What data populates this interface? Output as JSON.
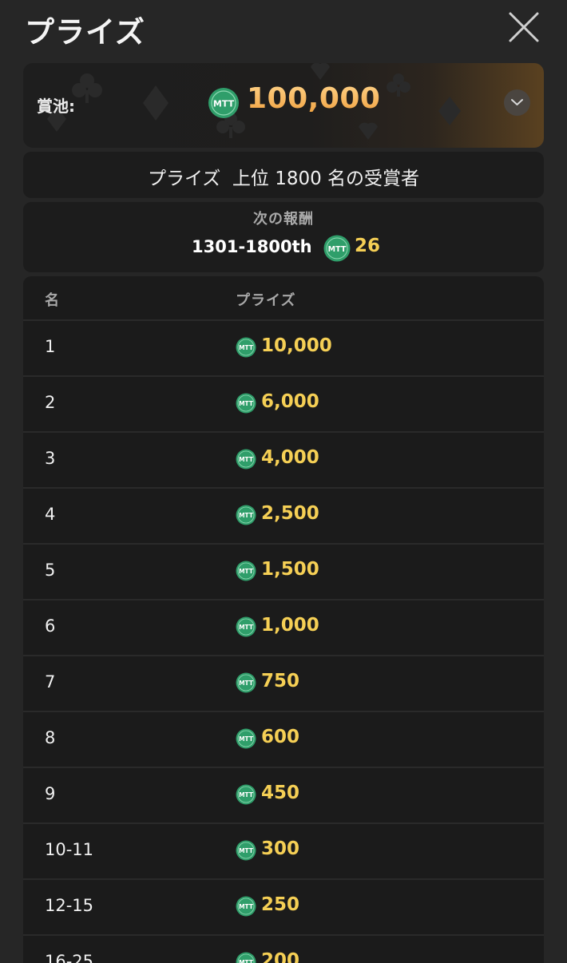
{
  "header": {
    "title": "プライズ"
  },
  "pool": {
    "label": "賞池:",
    "amount": "100,000",
    "coin": "MTT"
  },
  "winners": {
    "text": "プライズ  上位 1800 名の受賞者"
  },
  "next_reward": {
    "label": "次の報酬",
    "range": "1301-1800th",
    "value": "26"
  },
  "table": {
    "col_rank": "名",
    "col_prize": "プライズ",
    "rows": [
      {
        "rank": "1",
        "prize": "10,000"
      },
      {
        "rank": "2",
        "prize": "6,000"
      },
      {
        "rank": "3",
        "prize": "4,000"
      },
      {
        "rank": "4",
        "prize": "2,500"
      },
      {
        "rank": "5",
        "prize": "1,500"
      },
      {
        "rank": "6",
        "prize": "1,000"
      },
      {
        "rank": "7",
        "prize": "750"
      },
      {
        "rank": "8",
        "prize": "600"
      },
      {
        "rank": "9",
        "prize": "450"
      },
      {
        "rank": "10-11",
        "prize": "300"
      },
      {
        "rank": "12-15",
        "prize": "250"
      },
      {
        "rank": "16-25",
        "prize": "200"
      }
    ]
  },
  "colors": {
    "background": "#262626",
    "card": "#1c1c1c",
    "gold": "#f5cf55",
    "coin_green": "#2f9e6a"
  },
  "icons": {
    "close": "close-icon",
    "toggle": "chevron-down-icon",
    "coin": "mtt-coin-icon"
  }
}
